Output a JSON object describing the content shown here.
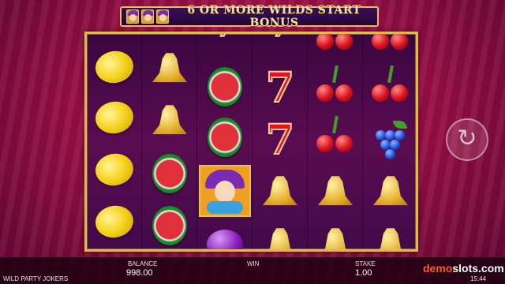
{
  "banner": {
    "text": "6 OR MORE WILDS START BONUS"
  },
  "reels": [
    [
      "lemon",
      "lemon",
      "lemon",
      "lemon"
    ],
    [
      "bell",
      "bell",
      "melon",
      "melon"
    ],
    [
      "seven",
      "melon",
      "melon",
      "joker",
      "plum"
    ],
    [
      "seven",
      "seven",
      "seven",
      "bell",
      "bell"
    ],
    [
      "cherry",
      "cherry",
      "cherry",
      "bell",
      "bell"
    ],
    [
      "cherry",
      "cherry",
      "grapes",
      "bell",
      "bell"
    ]
  ],
  "footer": {
    "balance_label": "BALANCE",
    "balance_value": "998.00",
    "win_label": "WIN",
    "stake_label": "STAKE",
    "stake_value": "1.00",
    "game_title": "WILD PARTY JOKERS",
    "brand_demo": "demo",
    "brand_slots": "slots.com",
    "clock": "15:44"
  },
  "controls": {
    "spin_icon": "spin-arrow-icon"
  },
  "colors": {
    "frame_gold": "#e2b850",
    "background": "#9c0f47",
    "brand_accent": "#ff5a1f"
  }
}
